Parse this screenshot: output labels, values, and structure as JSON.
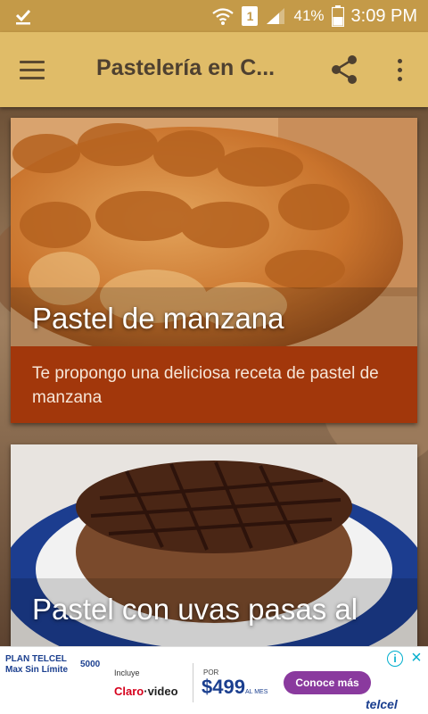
{
  "status_bar": {
    "notification_icon": "download-done-icon",
    "wifi_icon": "wifi-icon",
    "sim_label": "1",
    "signal_icon": "signal-icon",
    "battery_percent": "41%",
    "battery_icon": "battery-icon",
    "time": "3:09 PM"
  },
  "app_bar": {
    "menu_icon": "menu-icon",
    "title": "Pastelería en C...",
    "share_icon": "share-icon",
    "more_icon": "more-vert-icon"
  },
  "recipes": [
    {
      "title": "Pastel de manzana",
      "description": "Te propongo una deliciosa receta de pastel de manzana"
    },
    {
      "title": "Pastel con uvas pasas al"
    }
  ],
  "ad": {
    "plan_line1": "PLAN TELCEL",
    "plan_line2": "Max Sin Límite",
    "plan_amount": "5000",
    "includes": "Incluye",
    "claro_brand": "Claro",
    "video_label": "video",
    "por": "POR",
    "price": "$499",
    "per_month": "AL MES",
    "cta": "Conoce más",
    "brand": "telcel"
  },
  "colors": {
    "status_bar": "#c49a48",
    "app_bar": "#e0bc68",
    "description_bg": "#a2370b"
  }
}
